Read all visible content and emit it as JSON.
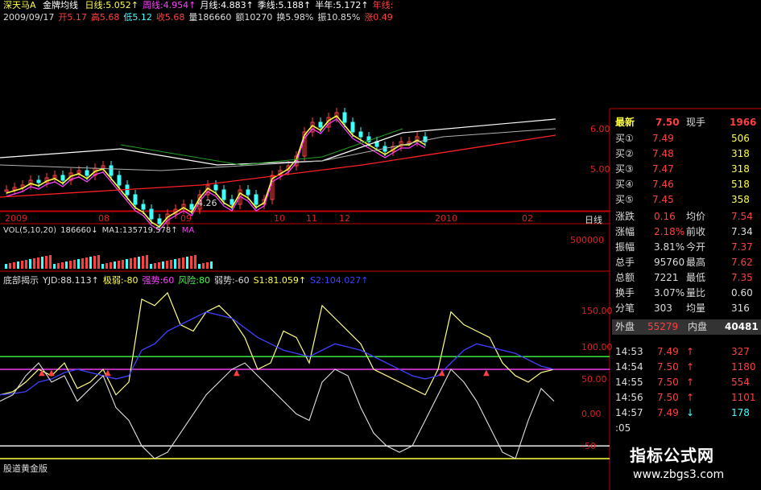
{
  "header": {
    "stock": "深天马A",
    "indicator": "金牌均线",
    "ma": [
      {
        "label": "日线:5.052↑",
        "color": "#ffff40"
      },
      {
        "label": "周线:4.954↑",
        "color": "#ff40ff"
      },
      {
        "label": "月线:4.883↑",
        "color": "#ffffff"
      },
      {
        "label": "季线:5.188↑",
        "color": "#ffffff"
      },
      {
        "label": "半年:5.172↑",
        "color": "#ffffff"
      },
      {
        "label": "年线:",
        "color": "#ff4040"
      }
    ],
    "line2": [
      {
        "label": "2009/09/17",
        "color": "#ddd"
      },
      {
        "label": "开5.17",
        "color": "#ff4040"
      },
      {
        "label": "高5.68",
        "color": "#ff4040"
      },
      {
        "label": "低5.12",
        "color": "#40ffff"
      },
      {
        "label": "收5.68",
        "color": "#ff4040"
      },
      {
        "label": "量186660",
        "color": "#ddd"
      },
      {
        "label": "额10270",
        "color": "#ddd"
      },
      {
        "label": "换5.98%",
        "color": "#ddd"
      },
      {
        "label": "振10.85%",
        "color": "#ddd"
      },
      {
        "label": "涨0.49",
        "color": "#ff4040"
      }
    ]
  },
  "price_axis": [
    "6.00",
    "5.00"
  ],
  "low_mark": "4.26",
  "x_axis": [
    "2009",
    "08",
    "09",
    "10",
    "11",
    "12",
    "2010",
    "02"
  ],
  "period_label": "日线",
  "volume": {
    "labels": [
      {
        "label": "VOL(5,10,20)",
        "color": "#ddd"
      },
      {
        "label": "186660↓",
        "color": "#ddd"
      },
      {
        "label": "MA1:135719.578↑",
        "color": "#ddd"
      },
      {
        "label": "MA",
        "color": "#ff40ff"
      }
    ],
    "axis": "500000"
  },
  "indicator_panel": {
    "labels": [
      {
        "label": "底部揭示",
        "color": "#ddd"
      },
      {
        "label": "YJD:88.113↑",
        "color": "#ddd"
      },
      {
        "label": "极弱:-80",
        "color": "#ffff40"
      },
      {
        "label": "强势:60",
        "color": "#ff40ff"
      },
      {
        "label": "风险:80",
        "color": "#40ff40"
      },
      {
        "label": "弱势:-60",
        "color": "#ddd"
      },
      {
        "label": "S1:81.059↑",
        "color": "#ffff40"
      },
      {
        "label": "S2:104.027↑",
        "color": "#4040ff"
      }
    ],
    "axis": [
      "150.00",
      "100.00",
      "50.00",
      "0.00",
      "-50"
    ],
    "footer": "股道黄金版"
  },
  "quote": {
    "title": "最新",
    "last": "7.50",
    "hand_label": "现手",
    "hand": "1966",
    "bids": [
      {
        "label": "买①",
        "price": "7.49",
        "vol": "506"
      },
      {
        "label": "买②",
        "price": "7.48",
        "vol": "318"
      },
      {
        "label": "买③",
        "price": "7.47",
        "vol": "318"
      },
      {
        "label": "买④",
        "price": "7.46",
        "vol": "518"
      },
      {
        "label": "买⑤",
        "price": "7.45",
        "vol": "358"
      }
    ],
    "stats": [
      {
        "l1": "涨跌",
        "v1": "0.16",
        "c1": "#ff4040",
        "l2": "均价",
        "v2": "7.54",
        "c2": "#ff4040"
      },
      {
        "l1": "涨幅",
        "v1": "2.18%",
        "c1": "#ff4040",
        "l2": "前收",
        "v2": "7.34",
        "c2": "#ddd"
      },
      {
        "l1": "振幅",
        "v1": "3.81%",
        "c1": "#ddd",
        "l2": "今开",
        "v2": "7.37",
        "c2": "#ff4040"
      },
      {
        "l1": "总手",
        "v1": "95760",
        "c1": "#ddd",
        "l2": "最高",
        "v2": "7.62",
        "c2": "#ff4040"
      },
      {
        "l1": "总额",
        "v1": "7221",
        "c1": "#ddd",
        "l2": "最低",
        "v2": "7.35",
        "c2": "#ff4040"
      },
      {
        "l1": "换手",
        "v1": "3.07%",
        "c1": "#ddd",
        "l2": "量比",
        "v2": "0.60",
        "c2": "#ddd"
      },
      {
        "l1": "分笔",
        "v1": "303",
        "c1": "#ddd",
        "l2": "均量",
        "v2": "316",
        "c2": "#ddd"
      }
    ],
    "outer_label": "外盘",
    "outer": "55279",
    "inner_label": "内盘",
    "inner": "40481"
  },
  "trades": [
    {
      "time": "14:53",
      "price": "7.49",
      "vol": "327",
      "dir": "↑",
      "vcolor": "#ff4040"
    },
    {
      "time": "14:54",
      "price": "7.50",
      "vol": "1180",
      "dir": "↑",
      "vcolor": "#ff4040"
    },
    {
      "time": "14:55",
      "price": "7.50",
      "vol": "554",
      "dir": "↑",
      "vcolor": "#ff4040"
    },
    {
      "time": "14:56",
      "price": "7.50",
      "vol": "1101",
      "dir": "↑",
      "vcolor": "#ff4040"
    },
    {
      "time": "14:57",
      "price": "7.49",
      "vol": "178",
      "dir": "↓",
      "vcolor": "#40ffff"
    },
    {
      "time": ":05",
      "price": "",
      "vol": "",
      "dir": "",
      "vcolor": "#ddd"
    }
  ],
  "watermark": {
    "title": "指标公式网",
    "url": "www.zbgs3.com"
  },
  "colors": {
    "up": "#ff4040",
    "down": "#40ffff",
    "grid": "#c00000"
  }
}
